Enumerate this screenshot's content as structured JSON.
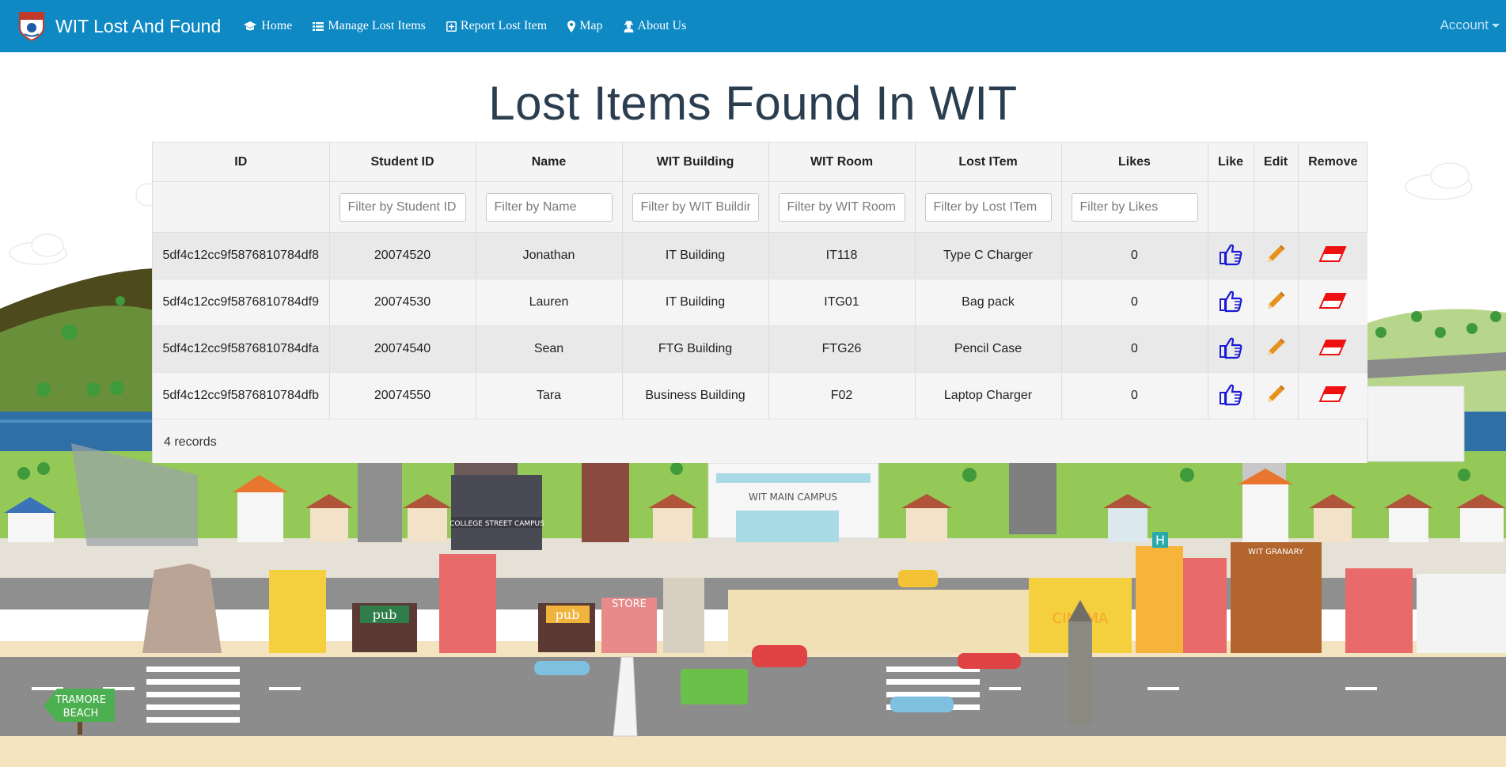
{
  "brand": {
    "title": "WIT Lost And Found"
  },
  "nav": [
    {
      "label": "Home",
      "icon": "graduation-cap-icon"
    },
    {
      "label": "Manage Lost Items",
      "icon": "list-icon"
    },
    {
      "label": "Report Lost Item",
      "icon": "plus-square-icon"
    },
    {
      "label": "Map",
      "icon": "map-marker-icon"
    },
    {
      "label": "About Us",
      "icon": "user-secret-icon"
    }
  ],
  "account": {
    "label": "Account"
  },
  "page": {
    "title": "Lost Items Found In WIT"
  },
  "table": {
    "columns": [
      "ID",
      "Student ID",
      "Name",
      "WIT Building",
      "WIT Room",
      "Lost ITem",
      "Likes",
      "Like",
      "Edit",
      "Remove"
    ],
    "filters": [
      "Filter by Student ID",
      "Filter by Name",
      "Filter by WIT Building",
      "Filter by WIT Room",
      "Filter by Lost ITem",
      "Filter by Likes"
    ],
    "rows": [
      {
        "id": "5df4c12cc9f5876810784df8",
        "student_id": "20074520",
        "name": "Jonathan",
        "building": "IT Building",
        "room": "IT118",
        "item": "Type C Charger",
        "likes": "0"
      },
      {
        "id": "5df4c12cc9f5876810784df9",
        "student_id": "20074530",
        "name": "Lauren",
        "building": "IT Building",
        "room": "ITG01",
        "item": "Bag pack",
        "likes": "0"
      },
      {
        "id": "5df4c12cc9f5876810784dfa",
        "student_id": "20074540",
        "name": "Sean",
        "building": "FTG Building",
        "room": "FTG26",
        "item": "Pencil Case",
        "likes": "0"
      },
      {
        "id": "5df4c12cc9f5876810784dfb",
        "student_id": "20074550",
        "name": "Tara",
        "building": "Business Building",
        "room": "F02",
        "item": "Laptop Charger",
        "likes": "0"
      }
    ],
    "footer": "4 records"
  },
  "scene": {
    "labels": {
      "main_campus": "WIT MAIN CAMPUS",
      "college_street": "COLLEGE STREET CAMPUS",
      "pub1": "pub",
      "pub2": "pub",
      "store": "STORE",
      "cinema": "CINEMA",
      "granary": "WIT GRANARY",
      "hospital": "H",
      "beach_line1": "TRAMORE",
      "beach_line2": "BEACH"
    }
  },
  "colors": {
    "navbar": "#0e89c4",
    "title": "#2b3e50",
    "like": "#1a1ad6",
    "edit": "#e8921e",
    "remove": "#ee1111"
  }
}
